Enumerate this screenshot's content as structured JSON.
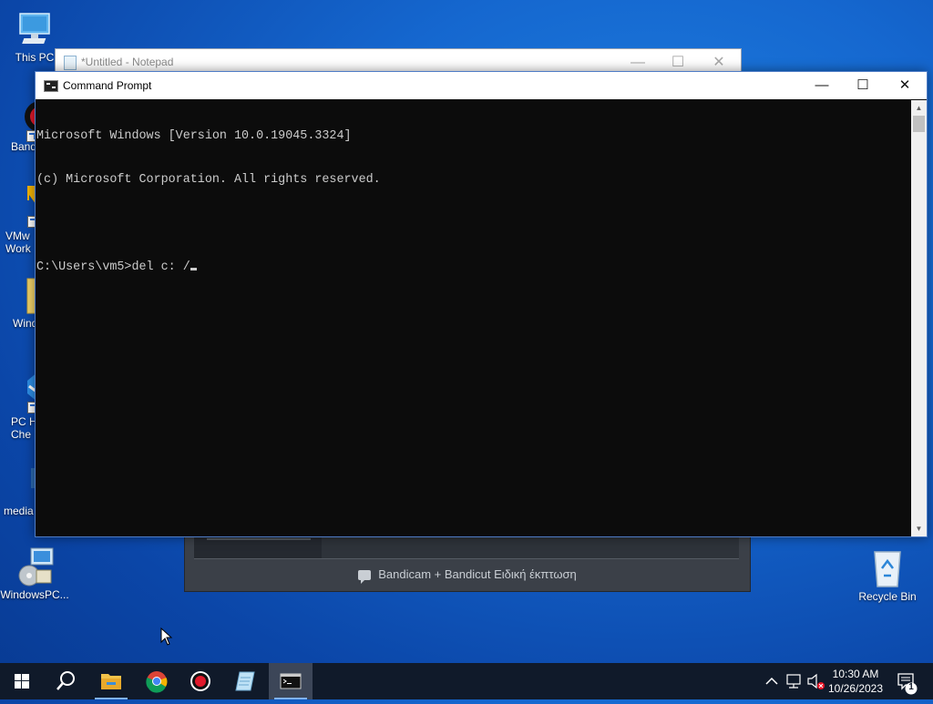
{
  "desktop": {
    "icons": [
      {
        "label": "This PC"
      },
      {
        "label": "Band"
      },
      {
        "label": "VMw\nWork"
      },
      {
        "label": "Wind"
      },
      {
        "label": "PC H\nChe"
      },
      {
        "label": "media"
      },
      {
        "label": "WindowsPC..."
      },
      {
        "label": "Recycle Bin"
      }
    ]
  },
  "notepad": {
    "title": "*Untitled - Notepad",
    "controls": {
      "minimize": "—",
      "maximize": "☐",
      "close": "✕"
    }
  },
  "cmd": {
    "title": "Command Prompt",
    "controls": {
      "minimize": "—",
      "maximize": "☐",
      "close": "✕"
    },
    "lines": [
      "Microsoft Windows [Version 10.0.19045.3324]",
      "(c) Microsoft Corporation. All rights reserved.",
      "",
      "C:\\Users\\vm5>del c: /"
    ]
  },
  "bandicam": {
    "promo_text": "Bandicam + Bandicut Ειδική έκπτωση"
  },
  "taskbar": {
    "clock": {
      "time": "10:30 AM",
      "date": "10/26/2023"
    },
    "notification_count": "1",
    "colors": {
      "bg": "#101a2a",
      "active": "#3c4658",
      "indicator": "#7fb2f0"
    }
  }
}
